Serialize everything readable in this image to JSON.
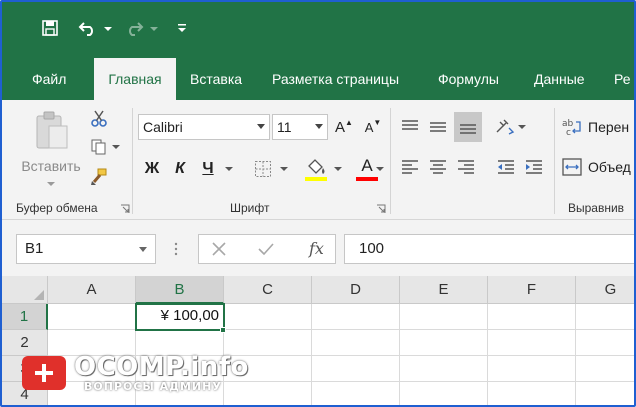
{
  "tabs": [
    {
      "label": "Файл",
      "active": false
    },
    {
      "label": "Главная",
      "active": true
    },
    {
      "label": "Вставка",
      "active": false
    },
    {
      "label": "Разметка страницы",
      "active": false
    },
    {
      "label": "Формулы",
      "active": false
    },
    {
      "label": "Данные",
      "active": false
    },
    {
      "label": "Ре",
      "active": false
    }
  ],
  "ribbon": {
    "clipboard": {
      "paste_label": "Вставить",
      "group_label": "Буфер обмена"
    },
    "font": {
      "font_name": "Calibri",
      "font_size": "11",
      "grow_label": "A",
      "shrink_label": "A",
      "bold_label": "Ж",
      "italic_label": "К",
      "underline_label": "Ч",
      "font_color_label": "A",
      "group_label": "Шрифт"
    },
    "alignment": {
      "wrap_label": "Перен",
      "merge_label": "Объед",
      "group_label": "Выравнив"
    }
  },
  "formula_bar": {
    "name_box": "B1",
    "fx_label": "fx",
    "value": "100"
  },
  "grid": {
    "columns": [
      "A",
      "B",
      "C",
      "D",
      "E",
      "F",
      "G"
    ],
    "rows": [
      "1",
      "2",
      "3",
      "4"
    ],
    "selected_column": "B",
    "selected_row": "1",
    "cell_b1": "¥ 100,00"
  },
  "watermark": {
    "title": "OCOMP.info",
    "subtitle": "ВОПРОСЫ АДМИНУ"
  },
  "colors": {
    "excel_green": "#217346",
    "ribbon_bg": "#f3f3f3",
    "fill_yellow": "#ffff00",
    "font_red": "#ff0000",
    "frame_blue": "#1f5fd1"
  }
}
